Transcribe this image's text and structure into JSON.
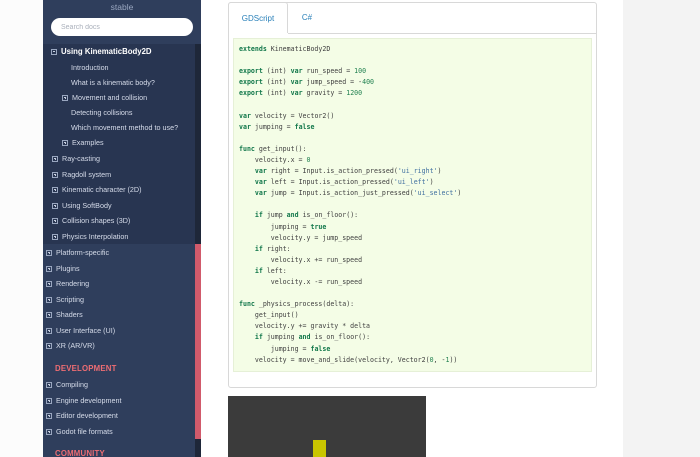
{
  "sidebar": {
    "version": "stable",
    "search_placeholder": "Search docs",
    "current_page": "Using KinematicBody2D",
    "subsections": [
      {
        "label": "Introduction"
      },
      {
        "label": "What is a kinematic body?"
      },
      {
        "label": "Movement and collision"
      },
      {
        "label": "Detecting collisions"
      },
      {
        "label": "Which movement method to use?"
      },
      {
        "label": "Examples"
      }
    ],
    "physics_siblings": [
      {
        "label": "Ray-casting"
      },
      {
        "label": "Ragdoll system"
      },
      {
        "label": "Kinematic character (2D)"
      },
      {
        "label": "Using SoftBody"
      },
      {
        "label": "Collision shapes (3D)"
      },
      {
        "label": "Physics Interpolation"
      }
    ],
    "top_sections": [
      {
        "label": "Platform-specific"
      },
      {
        "label": "Plugins"
      },
      {
        "label": "Rendering"
      },
      {
        "label": "Scripting"
      },
      {
        "label": "Shaders"
      },
      {
        "label": "User Interface (UI)"
      },
      {
        "label": "XR (AR/VR)"
      }
    ],
    "development_title": "DEVELOPMENT",
    "development_items": [
      {
        "label": "Compiling"
      },
      {
        "label": "Engine development"
      },
      {
        "label": "Editor development"
      },
      {
        "label": "Godot file formats"
      }
    ],
    "community_title": "COMMUNITY"
  },
  "tabs": {
    "gdscript": "GDScript",
    "csharp": "C#"
  },
  "code_lines": [
    "extends KinematicBody2D",
    "",
    "export (int) var run_speed = 100",
    "export (int) var jump_speed = -400",
    "export (int) var gravity = 1200",
    "",
    "var velocity = Vector2()",
    "var jumping = false",
    "",
    "func get_input():",
    "    velocity.x = 0",
    "    var right = Input.is_action_pressed('ui_right')",
    "    var left = Input.is_action_pressed('ui_left')",
    "    var jump = Input.is_action_just_pressed('ui_select')",
    "",
    "    if jump and is_on_floor():",
    "        jumping = true",
    "        velocity.y = jump_speed",
    "    if right:",
    "        velocity.x += run_speed",
    "    if left:",
    "        velocity.x -= run_speed",
    "",
    "func _physics_process(delta):",
    "    get_input()",
    "    velocity.y += gravity * delta",
    "    if jumping and is_on_floor():",
    "        jumping = false",
    "    velocity = move_and_slide(velocity, Vector2(0, -1))"
  ],
  "colors": {
    "sidebar_bg": "#2f3e5c",
    "accent_red": "#ee6d73",
    "link_blue": "#2980b9",
    "code_bg": "#f4fde6",
    "player_yellow": "#c9c500"
  }
}
